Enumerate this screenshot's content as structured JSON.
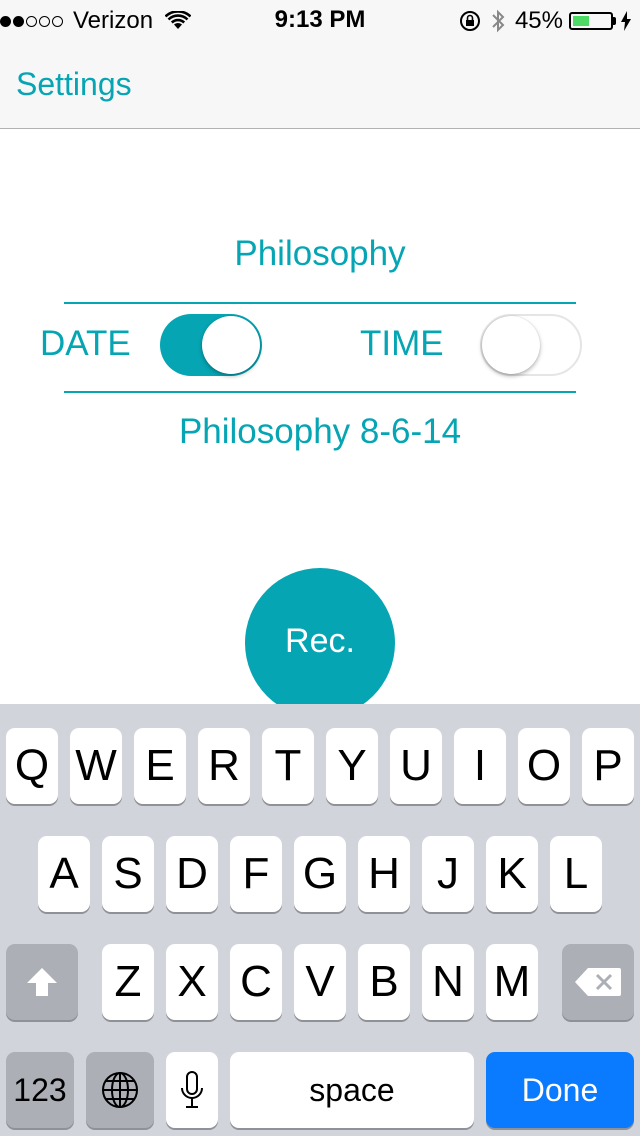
{
  "status_bar": {
    "signal_dots_filled": 2,
    "signal_dots_total": 5,
    "carrier": "Verizon",
    "time": "9:13 PM",
    "battery_percent": "45%",
    "battery_level": 0.45,
    "icons": [
      "wifi-icon",
      "rotation-lock-icon",
      "bluetooth-icon",
      "battery-icon",
      "charging-bolt-icon"
    ]
  },
  "nav": {
    "back_label": "Settings"
  },
  "recording": {
    "title": "Philosophy",
    "options": {
      "date_label": "DATE",
      "date_on": true,
      "time_label": "TIME",
      "time_on": false
    },
    "filename": "Philosophy 8-6-14",
    "rec_label": "Rec."
  },
  "keyboard": {
    "row1": [
      "Q",
      "W",
      "E",
      "R",
      "T",
      "Y",
      "U",
      "I",
      "O",
      "P"
    ],
    "row2": [
      "A",
      "S",
      "D",
      "F",
      "G",
      "H",
      "J",
      "K",
      "L"
    ],
    "row3": [
      "Z",
      "X",
      "C",
      "V",
      "B",
      "N",
      "M"
    ],
    "numbers_label": "123",
    "space_label": "space",
    "done_label": "Done"
  },
  "colors": {
    "accent": "#06a5b4",
    "done_blue": "#0a7aff",
    "keyboard_bg": "#d1d5db",
    "battery_green": "#4cd964"
  }
}
